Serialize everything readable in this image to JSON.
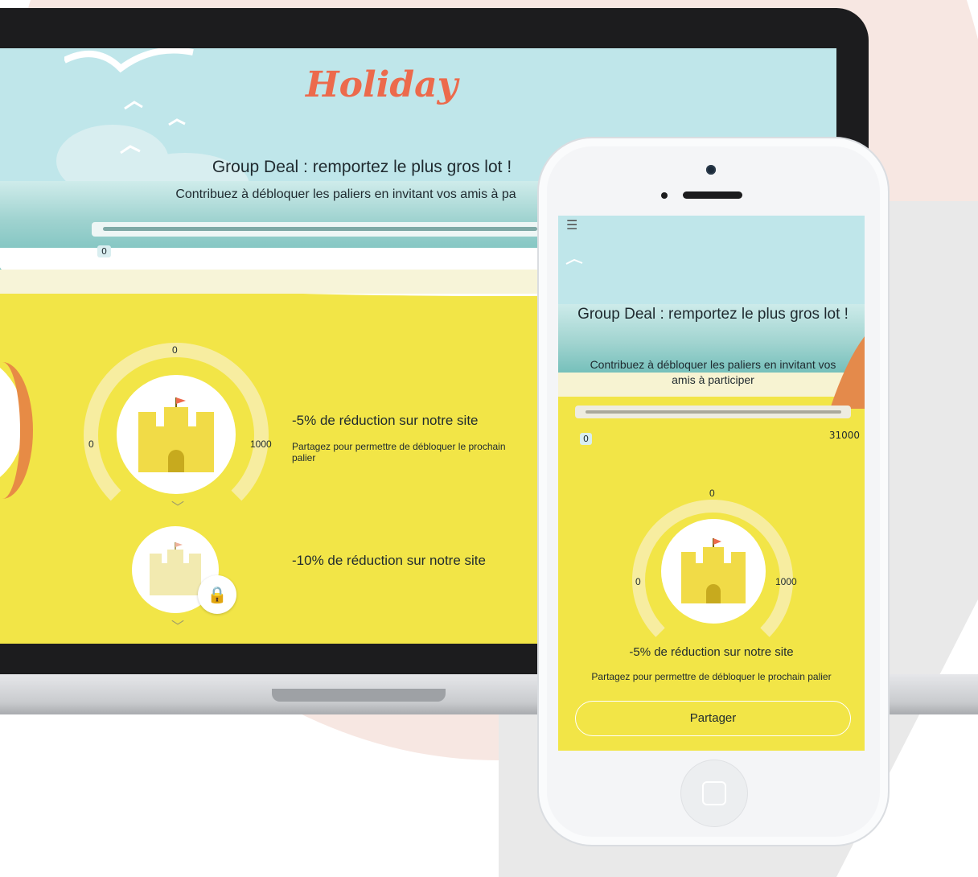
{
  "desktop": {
    "logo": "Holiday",
    "title": "Group Deal : remportez le plus gros lot !",
    "subtitle": "Contribuez à débloquer les paliers en invitant vos amis à pa",
    "progress": {
      "min_label": "0"
    },
    "tiers": [
      {
        "current": "0",
        "min": "0",
        "max": "1000",
        "reward": "-5% de réduction sur notre site",
        "hint": "Partagez pour permettre de débloquer le prochain palier",
        "locked": false
      },
      {
        "reward": "-10% de réduction sur notre site",
        "locked": true
      }
    ]
  },
  "mobile": {
    "title": "Group Deal : remportez le plus gros lot !",
    "subtitle": "Contribuez à débloquer les paliers en invitant vos amis à participer",
    "progress": {
      "min_label": "0",
      "max_label": "31000"
    },
    "tier": {
      "current": "0",
      "min": "0",
      "max": "1000",
      "reward": "-5% de réduction sur notre site",
      "hint": "Partagez pour permettre de débloquer le prochain palier"
    },
    "share_button": "Partager"
  },
  "colors": {
    "sand": "#f2e547",
    "sky": "#bfe6ea",
    "accent": "#ec6a4c",
    "castle": "#f1db47"
  },
  "icons": [
    "menu-icon",
    "lock-icon",
    "chevron-down-icon",
    "castle-icon",
    "flag-icon"
  ]
}
